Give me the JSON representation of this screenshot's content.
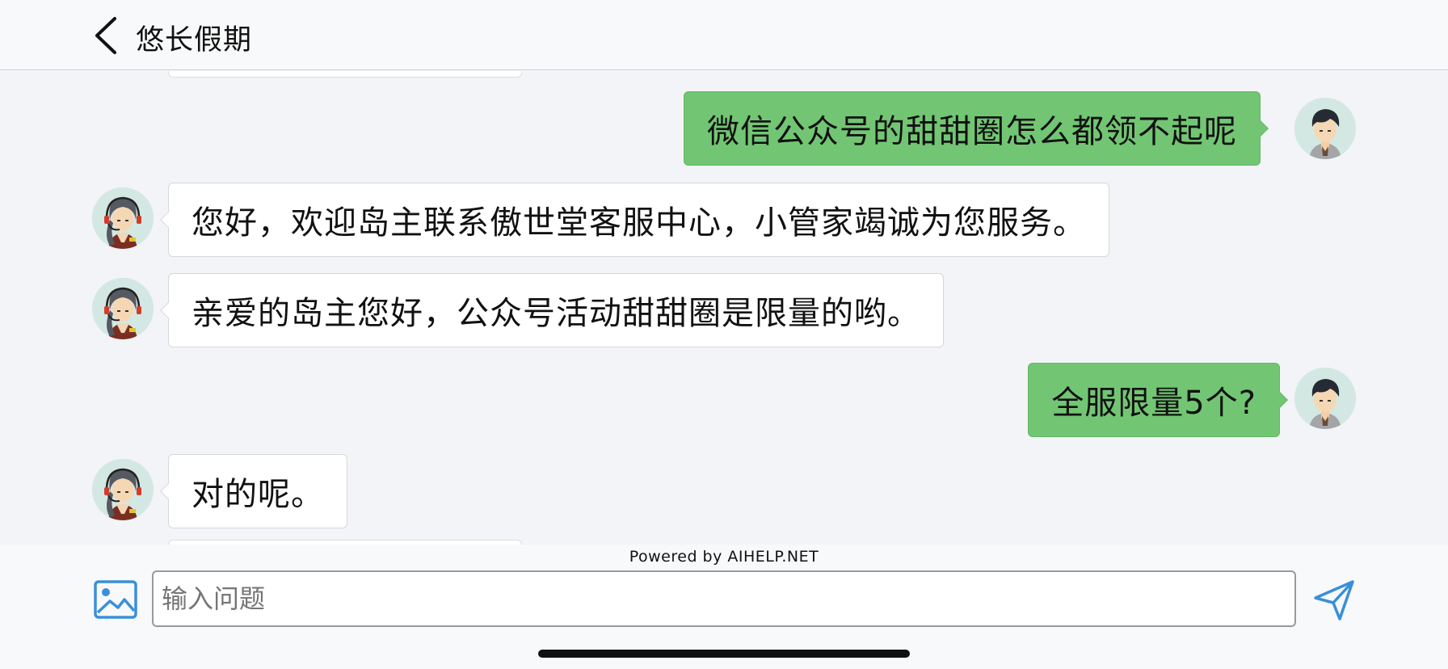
{
  "header": {
    "title": "悠长假期"
  },
  "messages": [
    {
      "role": "user",
      "text": "微信公众号的甜甜圈怎么都领不起呢"
    },
    {
      "role": "agent",
      "text": "您好，欢迎岛主联系傲世堂客服中心，小管家竭诚为您服务。"
    },
    {
      "role": "agent",
      "text": "亲爱的岛主您好，公众号活动甜甜圈是限量的哟。"
    },
    {
      "role": "user",
      "text": "全服限量5个?"
    },
    {
      "role": "agent",
      "text": "对的呢。"
    }
  ],
  "footer": {
    "powered_by": "Powered by AIHELP.NET",
    "input_placeholder": "输入问题"
  },
  "icons": {
    "back": "chevron-left-icon",
    "image": "image-icon",
    "send": "paper-plane-icon",
    "agent_avatar": "headset-agent-avatar",
    "user_avatar": "user-avatar"
  },
  "colors": {
    "user_bubble": "#72c673",
    "agent_bubble": "#ffffff",
    "chat_background": "#f3f4f7",
    "accent_blue": "#3a8fd9"
  }
}
